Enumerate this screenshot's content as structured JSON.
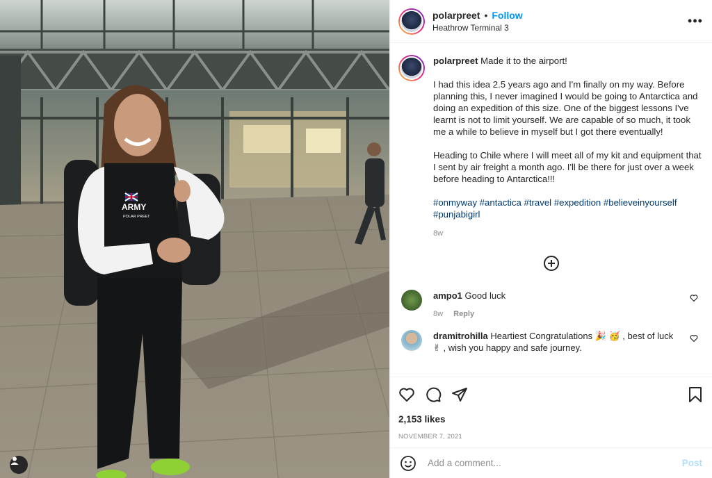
{
  "post": {
    "username": "polarpreet",
    "follow_label": "Follow",
    "separator": "•",
    "location": "Heathrow Terminal 3",
    "more_label": "•••"
  },
  "caption": {
    "username": "polarpreet",
    "first_line": "Made it to the airport!",
    "paragraph1": "I had this idea 2.5 years ago and I'm finally on my way. Before planning this, I never imagined I would be going to Antarctica and doing an expedition of this size. One of the biggest lessons I've learnt is not to limit yourself. We are capable of so much, it took me a while to believe in myself but I got there eventually!",
    "paragraph2": "Heading to Chile where I will meet all of my kit and equipment that I sent by air freight a month ago. I'll be there for just over a week before heading to Antarctica!!!",
    "hashtags": [
      "#onmyway",
      "#antactica",
      "#travel",
      "#expedition",
      "#believeinyourself",
      "#punjabigirl"
    ],
    "time": "8w"
  },
  "comments": [
    {
      "username": "ampo1",
      "text": "Good luck",
      "time": "8w",
      "reply_label": "Reply",
      "avatar_color": "#4a7a3a"
    },
    {
      "username": "dramitrohilla",
      "text": "Heartiest Congratulations 🎉 🥳 , best of luck ✌ , wish you happy and safe journey.",
      "avatar_color": "#7fb0c8"
    }
  ],
  "stats": {
    "likes": "2,153 likes",
    "date": "NOVEMBER 7, 2021"
  },
  "composer": {
    "placeholder": "Add a comment...",
    "post_label": "Post"
  },
  "badge": {
    "army": "ARMY",
    "name": "POLAR PREET"
  },
  "colors": {
    "accent": "#0095f6",
    "hashtag": "#00376b",
    "muted": "#8e8e8e",
    "post_disabled": "#b2dffc"
  }
}
